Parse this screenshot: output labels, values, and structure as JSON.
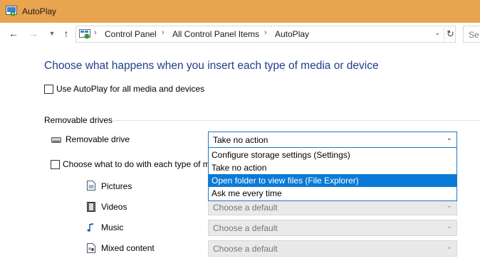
{
  "window": {
    "title": "AutoPlay"
  },
  "nav": {
    "breadcrumbs": [
      "Control Panel",
      "All Control Panel Items",
      "AutoPlay"
    ],
    "search_placeholder": "Se"
  },
  "page": {
    "heading": "Choose what happens when you insert each type of media or device",
    "use_autoplay_label": "Use AutoPlay for all media and devices",
    "use_autoplay_checked": false
  },
  "removable": {
    "section_title": "Removable drives",
    "drive_label": "Removable drive",
    "selected": "Take no action",
    "options": [
      "Configure storage settings (Settings)",
      "Take no action",
      "Open folder to view files (File Explorer)",
      "Ask me every time"
    ],
    "highlighted_index": 2,
    "choose_each_label": "Choose what to do with each type of m",
    "choose_each_checked": false
  },
  "media": [
    {
      "label": "Pictures",
      "value": "",
      "icon": "pictures-icon"
    },
    {
      "label": "Videos",
      "value": "Choose a default",
      "icon": "videos-icon"
    },
    {
      "label": "Music",
      "value": "Choose a default",
      "icon": "music-icon"
    },
    {
      "label": "Mixed content",
      "value": "Choose a default",
      "icon": "mixed-content-icon"
    }
  ],
  "colors": {
    "titlebar": "#e8a44e",
    "heading": "#1f3f8a",
    "highlight": "#0a7ad6",
    "focus_border": "#1b78c9"
  }
}
